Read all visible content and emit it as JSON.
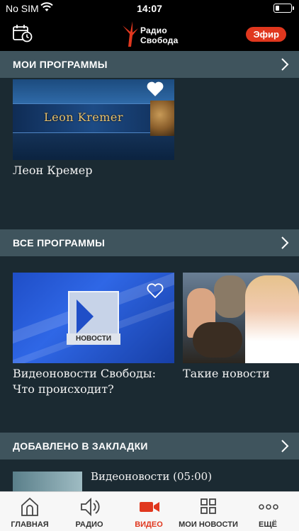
{
  "status_bar": {
    "carrier": "No SIM",
    "time": "14:07"
  },
  "header": {
    "logo_line1": "Радио",
    "logo_line2": "Свобода",
    "live_label": "Эфир",
    "brand_color": "#e0371e"
  },
  "sections": {
    "my_programs": {
      "title": "МОИ ПРОГРАММЫ",
      "items": [
        {
          "title": "Леон Кремер",
          "thumb_text": "Leon Kremer",
          "favorited": true
        }
      ]
    },
    "all_programs": {
      "title": "ВСЕ ПРОГРАММЫ",
      "items": [
        {
          "title": "Видеоновости Свободы: Что происходит?",
          "thumb_text": "НОВОСТИ",
          "favorited": false
        },
        {
          "title": "Такие новости"
        }
      ]
    },
    "bookmarks": {
      "title": "ДОБАВЛЕНО В ЗАКЛАДКИ",
      "items": [
        {
          "title": "Видеоновости (05:00)"
        }
      ]
    }
  },
  "tab_bar": {
    "active_color": "#e0371e",
    "tabs": [
      {
        "label": "ГЛАВНАЯ",
        "icon": "home-icon"
      },
      {
        "label": "РАДИО",
        "icon": "speaker-icon"
      },
      {
        "label": "ВИДЕО",
        "icon": "video-camera-icon",
        "active": true
      },
      {
        "label": "МОИ НОВОСТИ",
        "icon": "grid-icon"
      },
      {
        "label": "ЕЩЁ",
        "icon": "more-icon"
      }
    ]
  }
}
